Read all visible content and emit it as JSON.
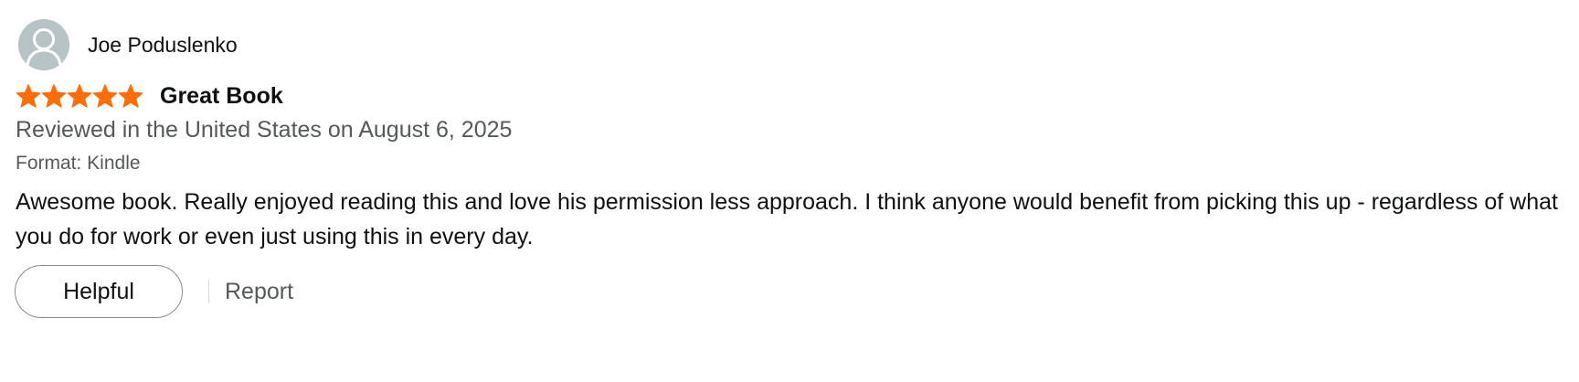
{
  "review": {
    "reviewer_name": "Joe Poduslenko",
    "avatar_icon": "person-silhouette-icon",
    "rating": 5,
    "rating_max": 5,
    "star_color": "#ff6d06",
    "title": "Great Book",
    "date_line": "Reviewed in the United States on August 6, 2025",
    "format_line": "Format: Kindle",
    "body": "Awesome book. Really enjoyed reading this and love his permission less approach. I think anyone would benefit from picking this up - regardless of what you do for work or even just using this in every day."
  },
  "actions": {
    "helpful_label": "Helpful",
    "report_label": "Report"
  }
}
